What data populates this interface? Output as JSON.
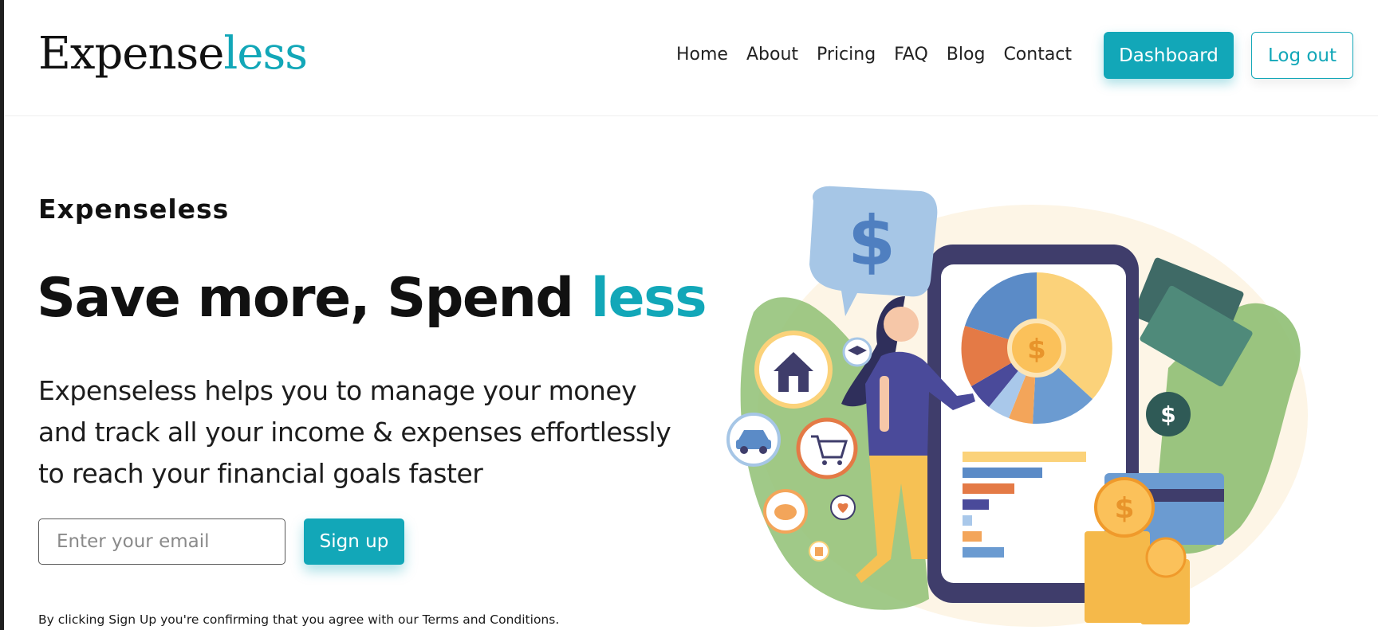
{
  "header": {
    "logo_main": "Expense",
    "logo_accent": "less",
    "nav": [
      "Home",
      "About",
      "Pricing",
      "FAQ",
      "Blog",
      "Contact"
    ],
    "dashboard_label": "Dashboard",
    "logout_label": "Log out"
  },
  "hero": {
    "eyebrow": "Expenseless",
    "headline_main": "Save more, Spend ",
    "headline_accent": "less",
    "description": "Expenseless helps you to manage your money and track all your income & expenses effortlessly to reach your financial goals faster",
    "email_placeholder": "Enter your email",
    "signup_label": "Sign up",
    "terms": "By clicking Sign Up you're confirming that you agree with our Terms and Conditions."
  },
  "illustration": {
    "icons": [
      "dollar-speech-bubble-icon",
      "house-icon",
      "graduation-cap-icon",
      "car-icon",
      "shopping-cart-icon",
      "piggy-bank-icon",
      "heart-icon",
      "jar-icon",
      "banknote-icon",
      "credit-card-icon",
      "coin-stack-icon"
    ],
    "coin_symbol": "$"
  },
  "colors": {
    "accent": "#12a7b8",
    "text": "#111111"
  }
}
